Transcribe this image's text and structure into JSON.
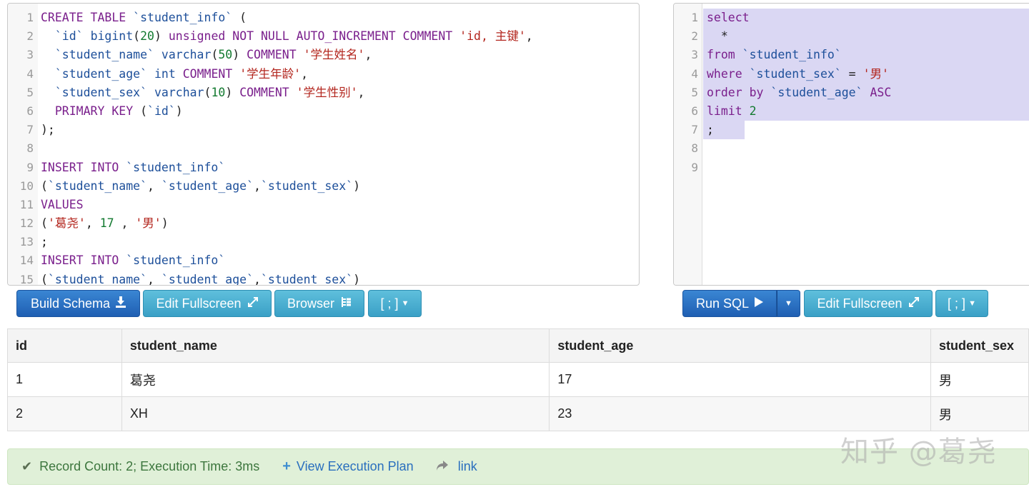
{
  "schema_editor": {
    "lines": [
      [
        [
          "kw",
          "CREATE TABLE "
        ],
        [
          "id",
          "`student_info`"
        ],
        [
          "pl",
          " ("
        ]
      ],
      [
        [
          "pl",
          "  "
        ],
        [
          "id",
          "`id`"
        ],
        [
          "pl",
          " "
        ],
        [
          "id",
          "bigint"
        ],
        [
          "pl",
          "("
        ],
        [
          "num",
          "20"
        ],
        [
          "pl",
          ") "
        ],
        [
          "kw",
          "unsigned NOT NULL AUTO_INCREMENT COMMENT "
        ],
        [
          "str",
          "'id, 主键'"
        ],
        [
          "pl",
          ","
        ]
      ],
      [
        [
          "pl",
          "  "
        ],
        [
          "id",
          "`student_name`"
        ],
        [
          "pl",
          " "
        ],
        [
          "id",
          "varchar"
        ],
        [
          "pl",
          "("
        ],
        [
          "num",
          "50"
        ],
        [
          "pl",
          ") "
        ],
        [
          "kw",
          "COMMENT "
        ],
        [
          "str",
          "'学生姓名'"
        ],
        [
          "pl",
          ","
        ]
      ],
      [
        [
          "pl",
          "  "
        ],
        [
          "id",
          "`student_age`"
        ],
        [
          "pl",
          " "
        ],
        [
          "id",
          "int"
        ],
        [
          "pl",
          " "
        ],
        [
          "kw",
          "COMMENT "
        ],
        [
          "str",
          "'学生年龄'"
        ],
        [
          "pl",
          ","
        ]
      ],
      [
        [
          "pl",
          "  "
        ],
        [
          "id",
          "`student_sex`"
        ],
        [
          "pl",
          " "
        ],
        [
          "id",
          "varchar"
        ],
        [
          "pl",
          "("
        ],
        [
          "num",
          "10"
        ],
        [
          "pl",
          ") "
        ],
        [
          "kw",
          "COMMENT "
        ],
        [
          "str",
          "'学生性别'"
        ],
        [
          "pl",
          ","
        ]
      ],
      [
        [
          "pl",
          "  "
        ],
        [
          "kw",
          "PRIMARY KEY"
        ],
        [
          "pl",
          " ("
        ],
        [
          "id",
          "`id`"
        ],
        [
          "pl",
          ")"
        ]
      ],
      [
        [
          "pl",
          ");"
        ]
      ],
      [],
      [
        [
          "kw",
          "INSERT INTO "
        ],
        [
          "id",
          "`student_info`"
        ]
      ],
      [
        [
          "pl",
          "("
        ],
        [
          "id",
          "`student_name`"
        ],
        [
          "pl",
          ", "
        ],
        [
          "id",
          "`student_age`"
        ],
        [
          "pl",
          ","
        ],
        [
          "id",
          "`student_sex`"
        ],
        [
          "pl",
          ")"
        ]
      ],
      [
        [
          "kw",
          "VALUES"
        ]
      ],
      [
        [
          "pl",
          "("
        ],
        [
          "str",
          "'葛尧'"
        ],
        [
          "pl",
          ", "
        ],
        [
          "num",
          "17"
        ],
        [
          "pl",
          " , "
        ],
        [
          "str",
          "'男'"
        ],
        [
          "pl",
          ")"
        ]
      ],
      [
        [
          "pl",
          ";"
        ]
      ],
      [
        [
          "kw",
          "INSERT INTO "
        ],
        [
          "id",
          "`student_info`"
        ]
      ],
      [
        [
          "pl",
          "("
        ],
        [
          "id",
          "`student_name`"
        ],
        [
          "pl",
          ", "
        ],
        [
          "id",
          "`student_age`"
        ],
        [
          "pl",
          ","
        ],
        [
          "id",
          "`student_sex`"
        ],
        [
          "pl",
          ")"
        ]
      ]
    ]
  },
  "query_editor": {
    "lines": [
      [
        [
          "kw",
          "select"
        ]
      ],
      [
        [
          "pl",
          "  *"
        ]
      ],
      [
        [
          "kw",
          "from "
        ],
        [
          "id",
          "`student_info`"
        ]
      ],
      [
        [
          "kw",
          "where "
        ],
        [
          "id",
          "`student_sex`"
        ],
        [
          "pl",
          " = "
        ],
        [
          "str",
          "'男'"
        ]
      ],
      [
        [
          "kw",
          "order by "
        ],
        [
          "id",
          "`student_age`"
        ],
        [
          "pl",
          " "
        ],
        [
          "kw",
          "ASC"
        ]
      ],
      [
        [
          "kw",
          "limit "
        ],
        [
          "num",
          "2"
        ]
      ],
      [
        [
          "pl",
          ";"
        ]
      ],
      [],
      []
    ],
    "highlighted_lines": 7
  },
  "schema_toolbar": {
    "build_label": "Build Schema",
    "edit_label": "Edit Fullscreen",
    "browser_label": "Browser",
    "delimiter_label": "[ ; ]"
  },
  "query_toolbar": {
    "run_label": "Run SQL",
    "edit_label": "Edit Fullscreen",
    "delimiter_label": "[ ; ]"
  },
  "results": {
    "columns": [
      "id",
      "student_name",
      "student_age",
      "student_sex"
    ],
    "rows": [
      [
        "1",
        "葛尧",
        "17",
        "男"
      ],
      [
        "2",
        "XH",
        "23",
        "男"
      ]
    ]
  },
  "status": {
    "message": "Record Count: 2; Execution Time: 3ms",
    "plan_link": "View Execution Plan",
    "share_link": "link"
  },
  "watermark": "知乎 @葛尧"
}
